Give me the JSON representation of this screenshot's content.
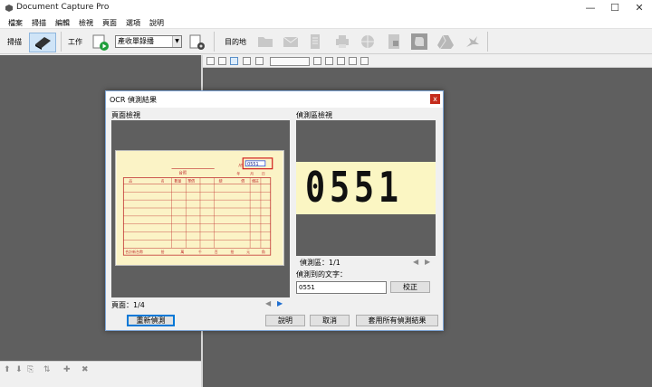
{
  "window": {
    "title": "Document Capture Pro",
    "min": "—",
    "max": "☐",
    "close": "✕"
  },
  "menu": [
    "檔案",
    "掃描",
    "編輯",
    "檢視",
    "頁面",
    "選項",
    "說明"
  ],
  "toolbar": {
    "scan_label": "掃描",
    "job_label": "工作",
    "job_select": "產收單錄播",
    "destination_label": "目的地"
  },
  "dialog": {
    "title": "OCR 偵測結果",
    "close": "x",
    "page_view_label": "頁面檢視",
    "region_view_label": "偵測區檢視",
    "page_counter": "頁面：1/4",
    "region_counter": "偵測區：1/1",
    "detected_text_label": "偵測到的文字：",
    "detected_text_value": "0551",
    "region_crop_text": "0551",
    "buttons": {
      "re_detect": "重新偵測",
      "correct": "校正",
      "help": "說明",
      "cancel": "取消",
      "apply_all": "套用所有偵測結果"
    }
  },
  "receipt": {
    "number": "0551",
    "title_suffix": "台照",
    "date_labels": [
      "年",
      "月",
      "日"
    ],
    "columns": [
      "品",
      "名",
      "數量",
      "單價",
      "總",
      "價",
      "備註"
    ],
    "total_row": [
      "合計新台幣",
      "拾",
      "萬",
      "千",
      "百",
      "拾",
      "元",
      "角"
    ]
  },
  "colors": {
    "panel": "#5f5f5f",
    "receipt_bg": "#fbf3c6",
    "receipt_lines": "#c03030",
    "highlight_box": "#d11a1a",
    "region_bg": "#fbf6c3"
  }
}
